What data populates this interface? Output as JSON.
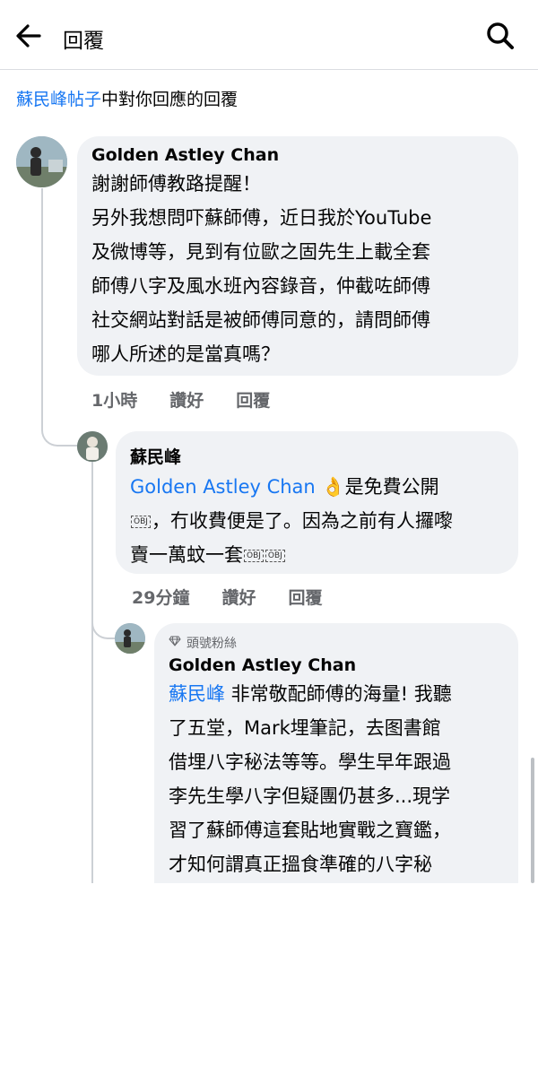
{
  "header": {
    "title": "回覆"
  },
  "context": {
    "link": "蘇民峰帖子",
    "text": "中對你回應的回覆"
  },
  "comments": [
    {
      "author": "Golden Astley Chan",
      "text": "謝謝師傅教路提醒！\n另外我想問吓蘇師傅，近日我於YouTube\n及微博等，見到有位歐之固先生上載全套\n師傅八字及風水班內容錄音，仲截咗師傅\n社交網站對話是被師傅同意的，請問師傅\n哪人所述的是當真嗎？",
      "time": "1小時",
      "like": "讚好",
      "reply": "回覆"
    },
    {
      "author": "蘇民峰",
      "mention": "Golden Astley Chan",
      "emoji": "👌",
      "text1": "是免費公開",
      "obj": "OBJ",
      "text2": "，冇收費便是了。因為之前有人攞嚟",
      "text3": "賣一萬蚊一套",
      "time": "29分鐘",
      "like": "讚好",
      "reply": "回覆"
    },
    {
      "badge": "頭號粉絲",
      "author": "Golden Astley Chan",
      "mention": "蘇民峰",
      "text1": " 非常敬配師傅的海量! 我聽",
      "text2": "了五堂，Mark埋筆記，去图書館\n借埋八字秘法等等。學生早年跟過\n李先生學八字但疑團仍甚多...現学\n習了蘇師傅這套貼地實戰之寶鑑，\n才知何謂真正搵食準確的八字秘"
    }
  ],
  "colors": {
    "link": "#1877f2",
    "bubble": "#f0f2f5",
    "meta": "#65676b"
  }
}
